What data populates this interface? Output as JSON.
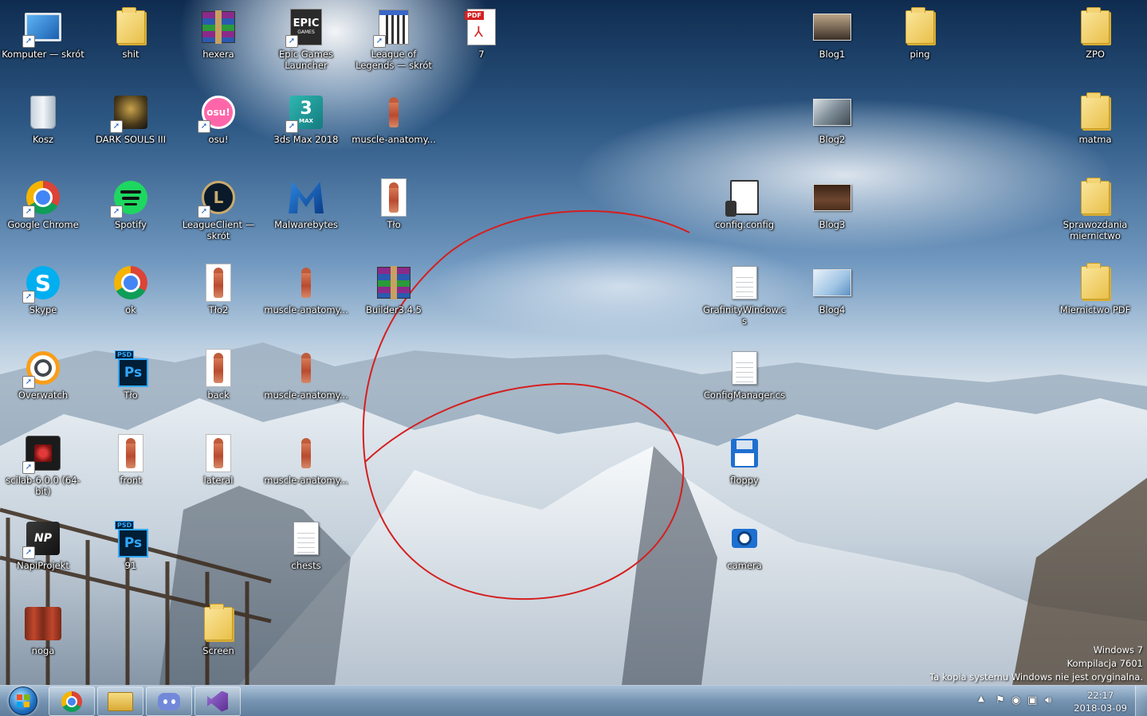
{
  "desktop_icons": [
    {
      "label": "Komputer — skrót",
      "icon": "computer-icon",
      "shortcut": true
    },
    {
      "label": "shit",
      "icon": "folder-icon",
      "shortcut": false
    },
    {
      "label": "hexera",
      "icon": "winrar-icon",
      "shortcut": false
    },
    {
      "label": "Epic Games Launcher",
      "icon": "epic-games-icon",
      "shortcut": true
    },
    {
      "label": "League of Legends — skrót",
      "icon": "lol-shortcut-icon",
      "shortcut": true
    },
    {
      "label": "7",
      "icon": "pdf-icon",
      "shortcut": false
    },
    {
      "label": "Blog1",
      "icon": "image-thumbnail",
      "shortcut": false
    },
    {
      "label": "ping",
      "icon": "folder-icon",
      "shortcut": false
    },
    {
      "label": "ZPO",
      "icon": "folder-icon",
      "shortcut": false
    },
    {
      "label": "Kosz",
      "icon": "recycle-bin-icon",
      "shortcut": false
    },
    {
      "label": "DARK SOULS III",
      "icon": "dark-souls-icon",
      "shortcut": true
    },
    {
      "label": "osu!",
      "icon": "osu-icon",
      "shortcut": true
    },
    {
      "label": "3ds Max 2018",
      "icon": "3dsmax-icon",
      "shortcut": true
    },
    {
      "label": "muscle-anatomy...",
      "icon": "anatomy-image-icon",
      "shortcut": false
    },
    {
      "label": "Blog2",
      "icon": "image-thumbnail",
      "shortcut": false
    },
    {
      "label": "matma",
      "icon": "folder-icon",
      "shortcut": false
    },
    {
      "label": "Google Chrome",
      "icon": "chrome-icon",
      "shortcut": true
    },
    {
      "label": "Spotify",
      "icon": "spotify-icon",
      "shortcut": true
    },
    {
      "label": "LeagueClient — skrót",
      "icon": "league-client-icon",
      "shortcut": true
    },
    {
      "label": "Malwarebytes",
      "icon": "malwarebytes-icon",
      "shortcut": false
    },
    {
      "label": "Tło",
      "icon": "anatomy-image-icon",
      "shortcut": false
    },
    {
      "label": "config.config",
      "icon": "config-file-icon",
      "shortcut": false
    },
    {
      "label": "Blog3",
      "icon": "image-thumbnail",
      "shortcut": false
    },
    {
      "label": "Sprawozdania miernictwo",
      "icon": "folder-icon",
      "shortcut": false
    },
    {
      "label": "Skype",
      "icon": "skype-icon",
      "shortcut": true
    },
    {
      "label": "ok",
      "icon": "chrome-icon",
      "shortcut": false
    },
    {
      "label": "Tło2",
      "icon": "anatomy-image-icon",
      "shortcut": false
    },
    {
      "label": "muscle-anatomy...",
      "icon": "anatomy-image-icon",
      "shortcut": false
    },
    {
      "label": "Builder3.4.5",
      "icon": "winrar-icon",
      "shortcut": false
    },
    {
      "label": "GrafinityWindow.cs",
      "icon": "text-file-icon",
      "shortcut": false
    },
    {
      "label": "Blog4",
      "icon": "image-thumbnail",
      "shortcut": false
    },
    {
      "label": "Miernictwo PDF",
      "icon": "folder-icon",
      "shortcut": false
    },
    {
      "label": "Overwatch",
      "icon": "overwatch-icon",
      "shortcut": true
    },
    {
      "label": "Tło",
      "icon": "photoshop-icon",
      "shortcut": false
    },
    {
      "label": "back",
      "icon": "anatomy-image-icon",
      "shortcut": false
    },
    {
      "label": "muscle-anatomy...",
      "icon": "anatomy-image-icon",
      "shortcut": false
    },
    {
      "label": "ConfigManager.cs",
      "icon": "text-file-icon",
      "shortcut": false
    },
    {
      "label": "scilab-6.0.0 (64-bit)",
      "icon": "scilab-icon",
      "shortcut": true
    },
    {
      "label": "front",
      "icon": "anatomy-image-icon",
      "shortcut": false
    },
    {
      "label": "lateral",
      "icon": "anatomy-image-icon",
      "shortcut": false
    },
    {
      "label": "muscle-anatomy...",
      "icon": "anatomy-image-icon",
      "shortcut": false
    },
    {
      "label": "floppy",
      "icon": "floppy-icon",
      "shortcut": false
    },
    {
      "label": "NapiProjekt",
      "icon": "napiprojekt-icon",
      "shortcut": true
    },
    {
      "label": "91",
      "icon": "photoshop-icon",
      "shortcut": false
    },
    {
      "label": "chests",
      "icon": "text-file-icon",
      "shortcut": false
    },
    {
      "label": "camera",
      "icon": "camera-icon",
      "shortcut": false
    },
    {
      "label": "noga",
      "icon": "anatomy-image-icon",
      "shortcut": false
    },
    {
      "label": "Screen",
      "icon": "folder-icon",
      "shortcut": false
    }
  ],
  "icon_text": {
    "epic": "EPIC",
    "epic_sub": "GAMES",
    "pdf": "PDF",
    "max_num": "3",
    "max_sub": "MAX",
    "osu": "osu!",
    "psd": "PSD",
    "ps": "Ps"
  },
  "watermark": {
    "line1": "Windows 7",
    "line2": "Kompilacja 7601",
    "line3": "Ta kopia systemu Windows nie jest oryginalna."
  },
  "taskbar": {
    "pinned": [
      "chrome-taskbar-icon",
      "explorer-taskbar-icon",
      "discord-taskbar-icon",
      "visual-studio-taskbar-icon"
    ],
    "clock_time": "22:17",
    "clock_date": "2018-03-09"
  },
  "colors": {
    "annotation_red": "#d41f1f",
    "taskbar_tint": "#7896b4"
  }
}
